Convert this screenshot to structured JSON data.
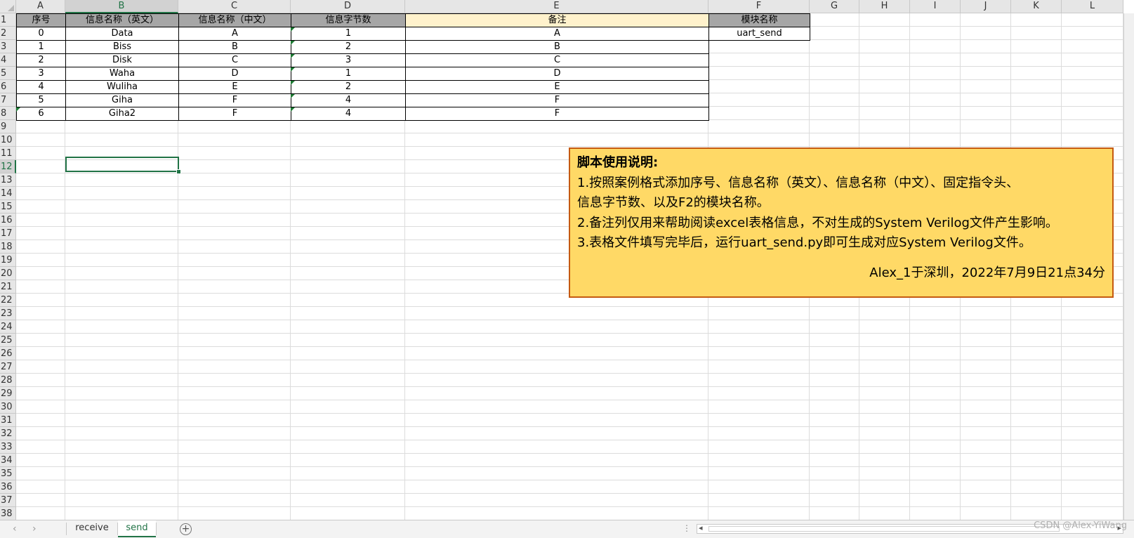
{
  "columns": [
    "A",
    "B",
    "C",
    "D",
    "E",
    "F",
    "G",
    "H",
    "I",
    "J",
    "K",
    "L"
  ],
  "rows": [
    "1",
    "2",
    "3",
    "4",
    "5",
    "6",
    "7",
    "8",
    "9",
    "10",
    "11",
    "12",
    "13",
    "14",
    "15",
    "16",
    "17",
    "18",
    "19",
    "20",
    "21",
    "22",
    "23",
    "24",
    "25",
    "26",
    "27",
    "28",
    "29",
    "30",
    "31",
    "32",
    "33",
    "34",
    "35",
    "36",
    "37",
    "38"
  ],
  "table": {
    "headers": [
      "序号",
      "信息名称（英文）",
      "信息名称（中文）",
      "信息字节数",
      "备注",
      "模块名称"
    ],
    "rows": [
      [
        "0",
        "Data",
        "A",
        "1",
        "A"
      ],
      [
        "1",
        "Biss",
        "B",
        "2",
        "B"
      ],
      [
        "2",
        "Disk",
        "C",
        "3",
        "C"
      ],
      [
        "3",
        "Waha",
        "D",
        "1",
        "D"
      ],
      [
        "4",
        "Wuliha",
        "E",
        "2",
        "E"
      ],
      [
        "5",
        "Giha",
        "F",
        "4",
        "F"
      ],
      [
        "6",
        "Giha2",
        "F",
        "4",
        "F"
      ]
    ],
    "module_name": "uart_send"
  },
  "note": {
    "title": "脚本使用说明:",
    "line1": "1.按照案例格式添加序号、信息名称（英文）、信息名称（中文）、固定指令头、",
    "line2": "信息字节数、以及F2的模块名称。",
    "line3": "2.备注列仅用来帮助阅读excel表格信息，不对生成的System Verilog文件产生影响。",
    "line4": "3.表格文件填写完毕后，运行uart_send.py即可生成对应System Verilog文件。",
    "signature": "Alex_1于深圳，2022年7月9日21点34分"
  },
  "sheet_tabs": {
    "tab1": "receive",
    "tab2": "send"
  },
  "active_tab": "send",
  "selected_cell": "B12",
  "watermark": "CSDN @Alex-YiWang",
  "colors": {
    "header_fill": "#a6a6a6",
    "note_header_fill": "#fff2cc",
    "textbox_fill": "#ffd966",
    "textbox_border": "#c55a11",
    "excel_green": "#217346"
  }
}
